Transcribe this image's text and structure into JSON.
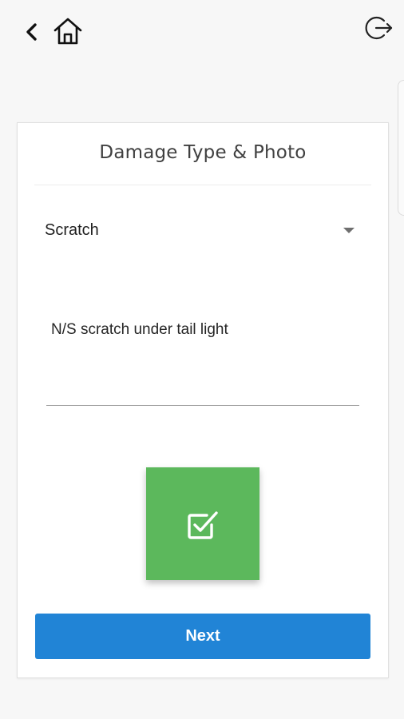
{
  "nav": {
    "back_icon": "chevron-left-icon",
    "home_icon": "home-icon",
    "logout_icon": "logout-icon"
  },
  "card": {
    "title": "Damage Type & Photo",
    "damage_type": {
      "selected": "Scratch"
    },
    "description": {
      "value": "N/S scratch under tail light"
    },
    "photo_tile": {
      "icon": "checkbox-checked-icon",
      "color": "#5cb85c"
    },
    "next_label": "Next"
  },
  "colors": {
    "accent": "#2184d6",
    "success": "#5cb85c",
    "background": "#f7f7f7"
  }
}
